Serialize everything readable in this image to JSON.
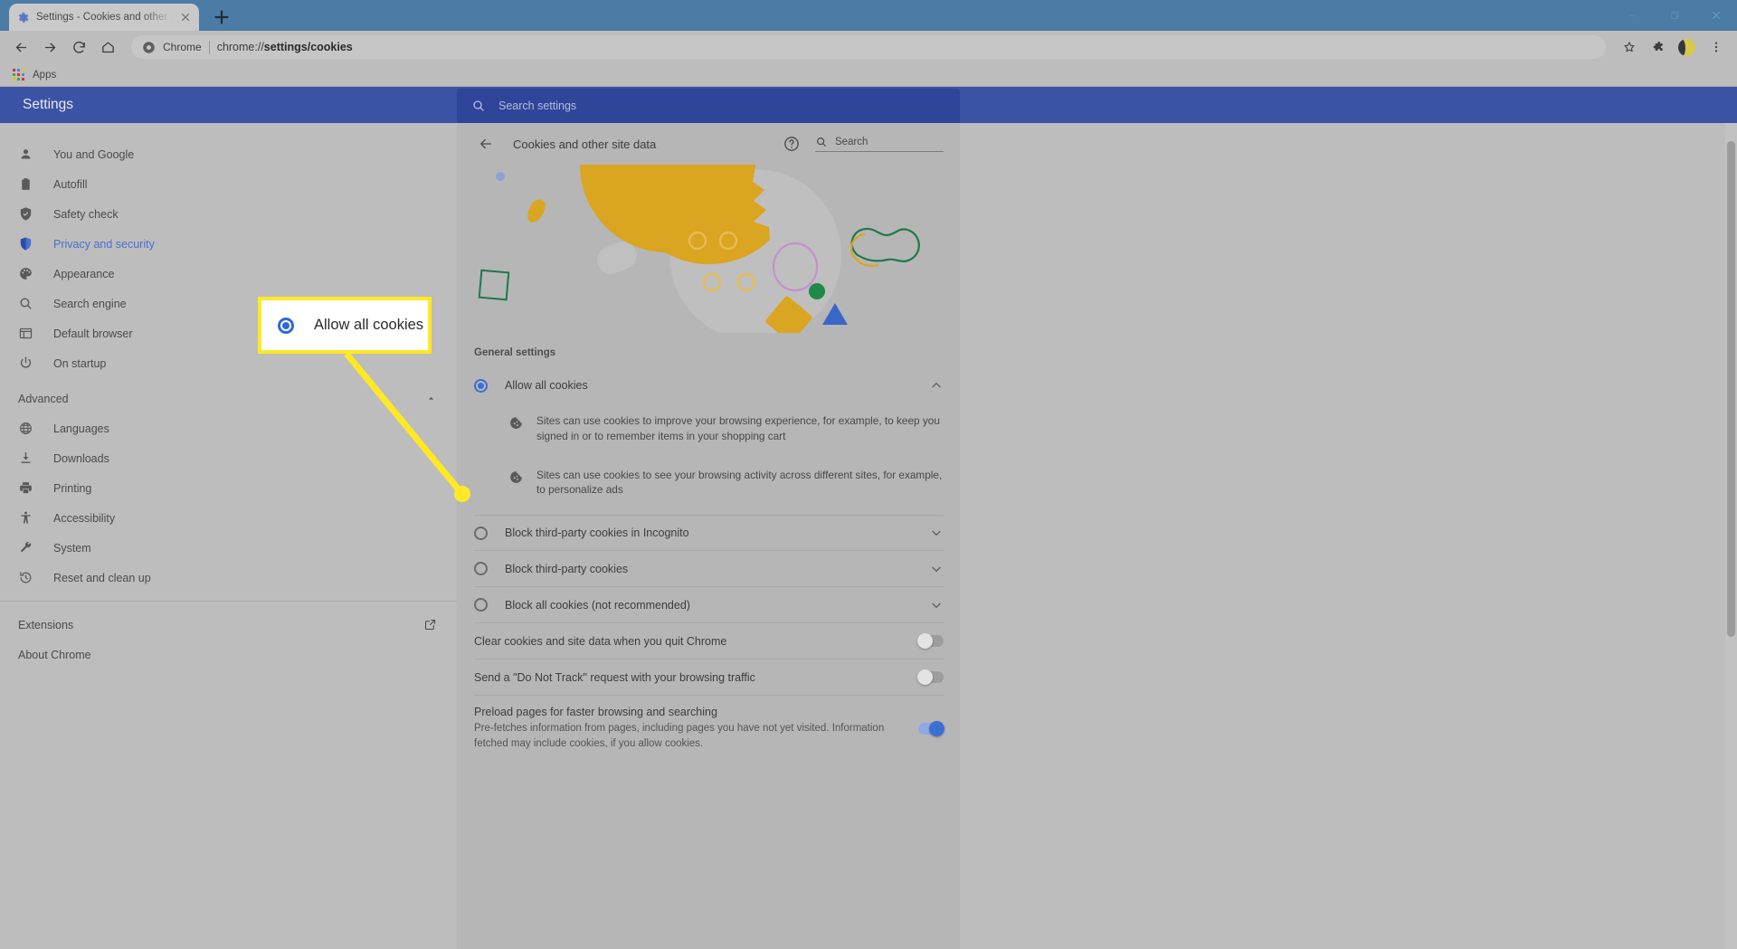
{
  "browser": {
    "tab": {
      "title": "Settings - Cookies and other site",
      "favicon_icon": "gear-icon",
      "close_icon": "close-icon"
    },
    "newtab_icon": "plus-icon",
    "window_controls": {
      "minimize_icon": "minimize-icon",
      "maximize_icon": "maximize-icon",
      "close_icon": "window-close-icon"
    },
    "toolbar": {
      "back_icon": "back-arrow-icon",
      "forward_icon": "forward-arrow-icon",
      "reload_icon": "reload-icon",
      "home_icon": "home-icon",
      "omnibox_chip": "Chrome",
      "omnibox_chip_icon": "chrome-logo-icon",
      "url_prefix": "chrome://",
      "url_rest": "settings/cookies",
      "bookmark_icon": "star-icon",
      "extensions_icon": "puzzle-piece-icon",
      "profile_icon": "avatar-icon",
      "menu_icon": "three-dot-menu-icon"
    },
    "bookmarks_bar": {
      "apps_icon": "apps-grid-icon",
      "apps_label": "Apps"
    }
  },
  "settings": {
    "brand": "Settings",
    "search": {
      "placeholder": "Search settings",
      "icon": "search-icon"
    },
    "nav": {
      "items": [
        {
          "label": "You and Google",
          "icon": "person-icon",
          "active": false
        },
        {
          "label": "Autofill",
          "icon": "clipboard-icon",
          "active": false
        },
        {
          "label": "Safety check",
          "icon": "shield-check-icon",
          "active": false
        },
        {
          "label": "Privacy and security",
          "icon": "shield-icon",
          "active": true
        },
        {
          "label": "Appearance",
          "icon": "palette-icon",
          "active": false
        },
        {
          "label": "Search engine",
          "icon": "search-icon",
          "active": false
        },
        {
          "label": "Default browser",
          "icon": "browser-window-icon",
          "active": false
        },
        {
          "label": "On startup",
          "icon": "power-icon",
          "active": false
        }
      ],
      "advanced": {
        "label": "Advanced",
        "chevron_icon": "chevron-up-icon"
      },
      "advanced_items": [
        {
          "label": "Languages",
          "icon": "globe-icon"
        },
        {
          "label": "Downloads",
          "icon": "download-icon"
        },
        {
          "label": "Printing",
          "icon": "printer-icon"
        },
        {
          "label": "Accessibility",
          "icon": "accessibility-icon"
        },
        {
          "label": "System",
          "icon": "wrench-icon"
        },
        {
          "label": "Reset and clean up",
          "icon": "history-restore-icon"
        }
      ],
      "extensions": {
        "label": "Extensions",
        "icon": "external-link-icon"
      },
      "about": {
        "label": "About Chrome"
      }
    }
  },
  "main": {
    "back_icon": "back-arrow-icon",
    "title": "Cookies and other site data",
    "help_icon": "help-circle-icon",
    "search": {
      "placeholder": "Search",
      "icon": "search-icon"
    },
    "hero_illustration": "cookie-illustration",
    "section_label": "General settings",
    "options": [
      {
        "label": "Allow all cookies",
        "selected": true,
        "expanded": true,
        "chevron_icon": "chevron-up-icon",
        "details": [
          {
            "icon": "cookie-icon",
            "text": "Sites can use cookies to improve your browsing experience, for example, to keep you signed in or to remember items in your shopping cart"
          },
          {
            "icon": "cookie-icon",
            "text": "Sites can use cookies to see your browsing activity across different sites, for example, to personalize ads"
          }
        ]
      },
      {
        "label": "Block third-party cookies in Incognito",
        "selected": false,
        "expanded": false,
        "chevron_icon": "chevron-down-icon",
        "details": []
      },
      {
        "label": "Block third-party cookies",
        "selected": false,
        "expanded": false,
        "chevron_icon": "chevron-down-icon",
        "details": []
      },
      {
        "label": "Block all cookies (not recommended)",
        "selected": false,
        "expanded": false,
        "chevron_icon": "chevron-down-icon",
        "details": []
      }
    ],
    "toggles": [
      {
        "label": "Clear cookies and site data when you quit Chrome",
        "sub": "",
        "on": false
      },
      {
        "label": "Send a \"Do Not Track\" request with your browsing traffic",
        "sub": "",
        "on": false
      },
      {
        "label": "Preload pages for faster browsing and searching",
        "sub": "Pre-fetches information from pages, including pages you have not yet visited. Information fetched may include cookies, if you allow cookies.",
        "on": true
      }
    ]
  },
  "annotation": {
    "callout": {
      "label": "Allow all cookies",
      "radio_selected": true
    },
    "highlight_color": "#ffe925"
  },
  "colors": {
    "settings_header_blue": "#3a53a4",
    "accent_blue": "#3b6fd4",
    "cookie_gold": "#daa520",
    "callout_yellow": "#ffe925",
    "tabstrip_blue": "#4a7ca5"
  }
}
